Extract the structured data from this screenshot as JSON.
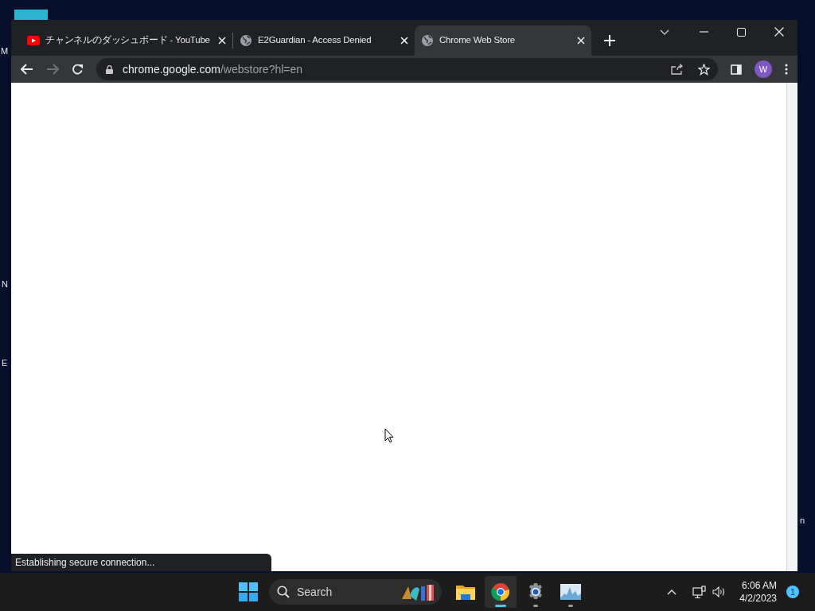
{
  "desktop": {
    "left_labels": [
      "M",
      "N",
      "E"
    ],
    "right_labels": [
      "n"
    ]
  },
  "browser": {
    "tabs": [
      {
        "title": "チャンネルのダッシュボード - YouTube",
        "kind": "youtube",
        "selected": false
      },
      {
        "title": "E2Guardian - Access Denied",
        "kind": "globe",
        "selected": false
      },
      {
        "title": "Chrome Web Store",
        "kind": "globe",
        "selected": true
      }
    ],
    "address": {
      "domain": "chrome.google.com",
      "path": "/webstore?hl=en"
    },
    "forward_disabled": true,
    "profile_initial": "W",
    "status": "Establishing secure connection..."
  },
  "taskbar": {
    "search_label": "Search",
    "apps": [
      {
        "kind": "folder",
        "active": false,
        "running": false
      },
      {
        "kind": "chrome",
        "active": true,
        "running": true
      },
      {
        "kind": "settings",
        "active": false,
        "running": true
      },
      {
        "kind": "monitor",
        "active": false,
        "running": true
      }
    ],
    "time": "6:06 AM",
    "date": "4/2/2023",
    "notification_count": "1"
  }
}
